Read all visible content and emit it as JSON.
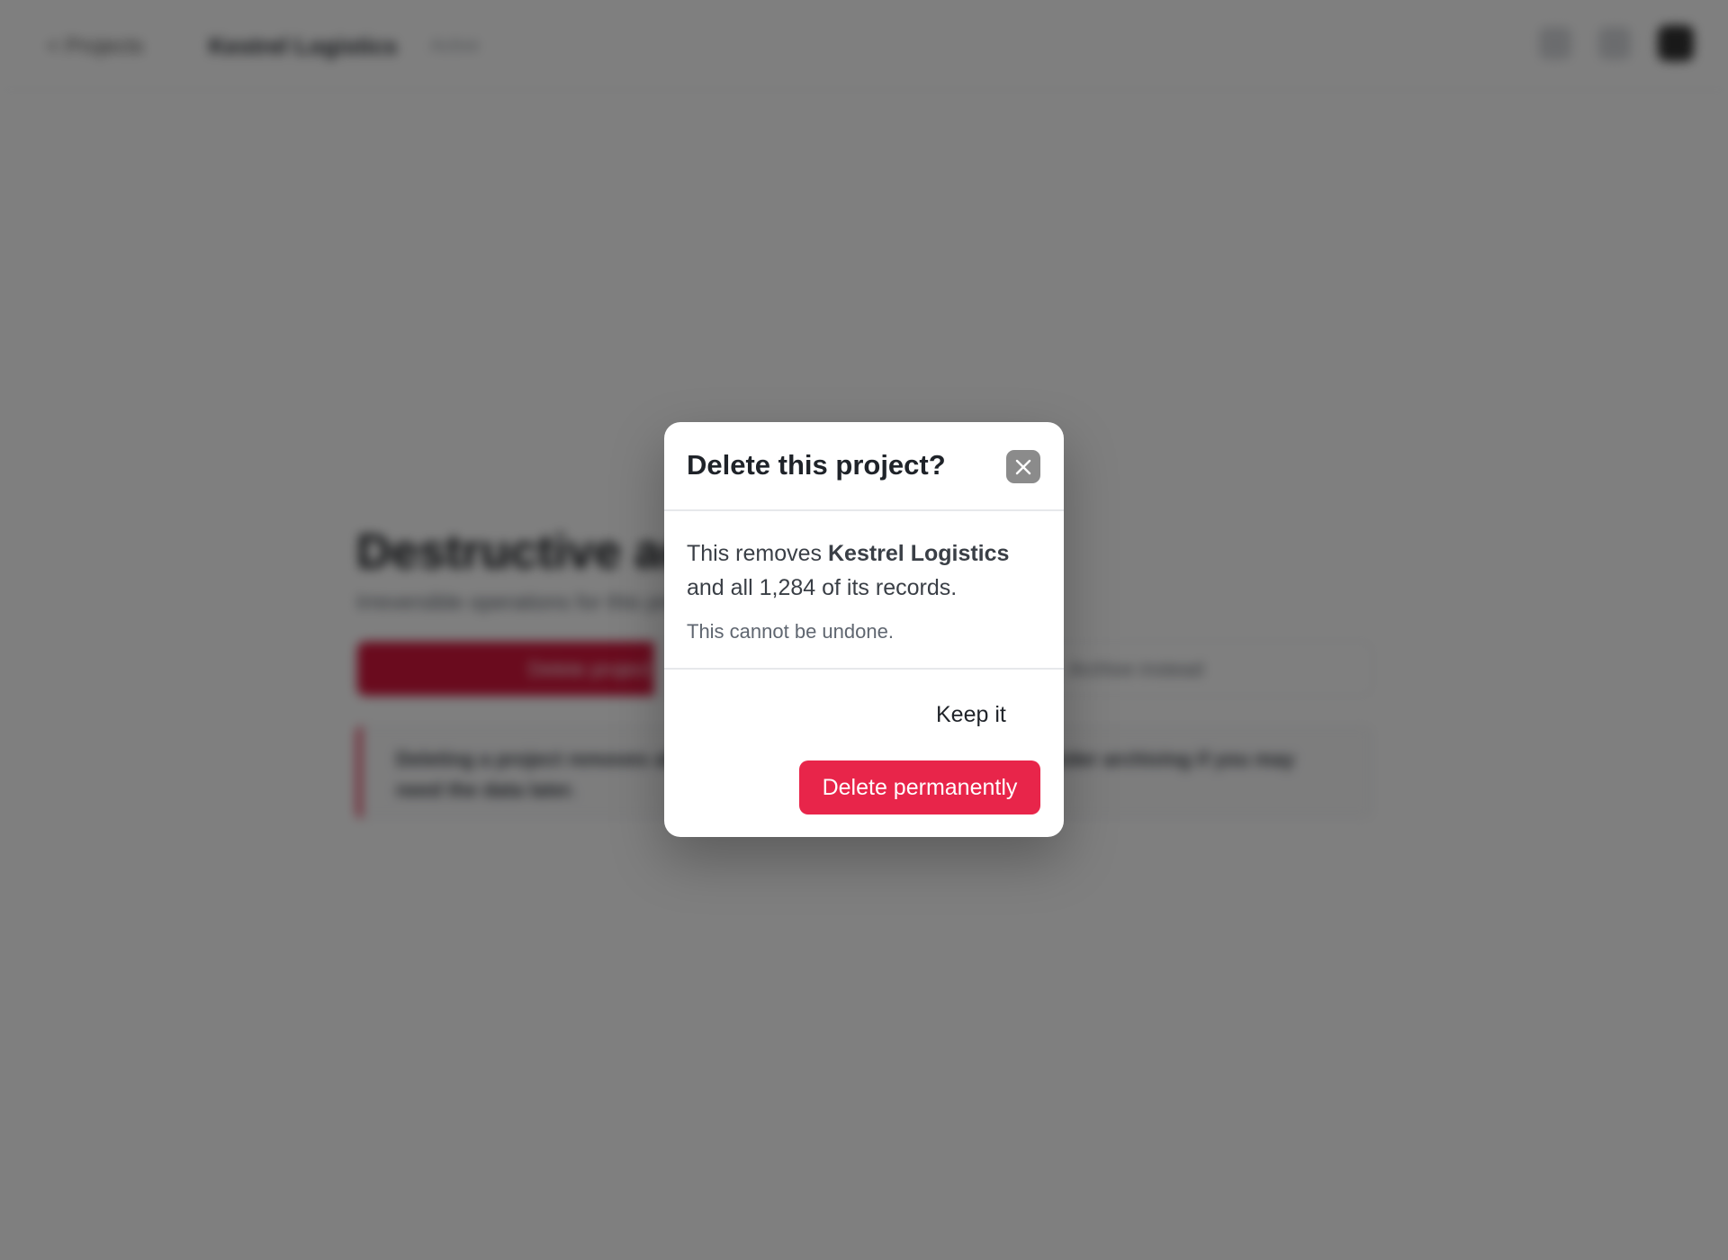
{
  "topbar": {
    "back_label": "< Projects",
    "project_title": "Kestrel Logistics",
    "meta": "Active"
  },
  "section": {
    "title": "Destructive actions",
    "subtitle": "Irreversible operations for this project"
  },
  "actions": {
    "danger_label": "Delete project",
    "other_label": "Archive instead"
  },
  "note": {
    "text": "Deleting a project removes all of its records, exports and history. Consider archiving if you may need the data later."
  },
  "dialog": {
    "title": "Delete this project?",
    "body_prefix": "This removes ",
    "project_name": "Kestrel Logistics",
    "body_suffix": " and all 1,284 of its records.",
    "warning": "This cannot be undone.",
    "keep_label": "Keep it",
    "delete_label": "Delete permanently",
    "close_icon": "close-icon"
  },
  "colors": {
    "danger": "#e8254a",
    "close_bg": "#8b8b8b",
    "overlay": "rgba(0,0,0,0.5)"
  }
}
